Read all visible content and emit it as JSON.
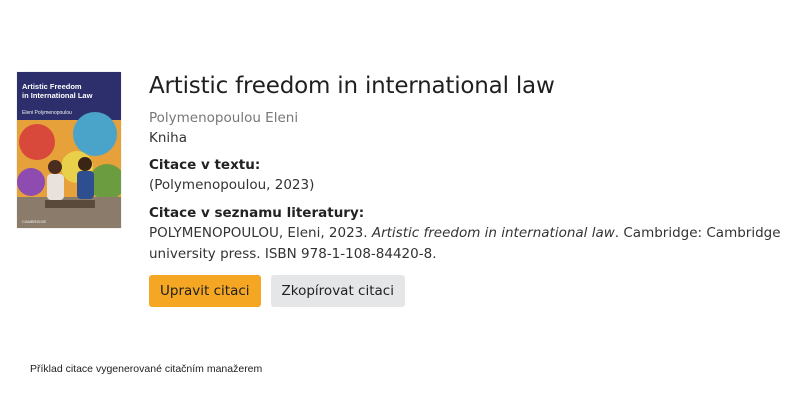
{
  "book": {
    "cover": {
      "title_line1": "Artistic Freedom",
      "title_line2": "in International Law",
      "author": "Eleni Polymenopoulou",
      "publisher": "CAMBRIDGE"
    },
    "title": "Artistic freedom in international law",
    "author": "Polymenopoulou Eleni",
    "type": "Kniha"
  },
  "in_text": {
    "label": "Citace v textu:",
    "value": "(Polymenopoulou, 2023)"
  },
  "bibliography": {
    "label": "Citace v seznamu literatury:",
    "prefix": "POLYMENOPOULOU, Eleni, 2023. ",
    "italic_title": "Artistic freedom in international law",
    "suffix": ". Cambridge: Cambridge university press. ISBN 978-1-108-84420-8."
  },
  "actions": {
    "edit_label": "Upravit citaci",
    "copy_label": "Zkopírovat citaci"
  },
  "caption": "Příklad citace vygenerované citačním manažerem",
  "colors": {
    "primary_button": "#f5a623",
    "secondary_button": "#e4e6e8",
    "author_text": "#777777"
  }
}
